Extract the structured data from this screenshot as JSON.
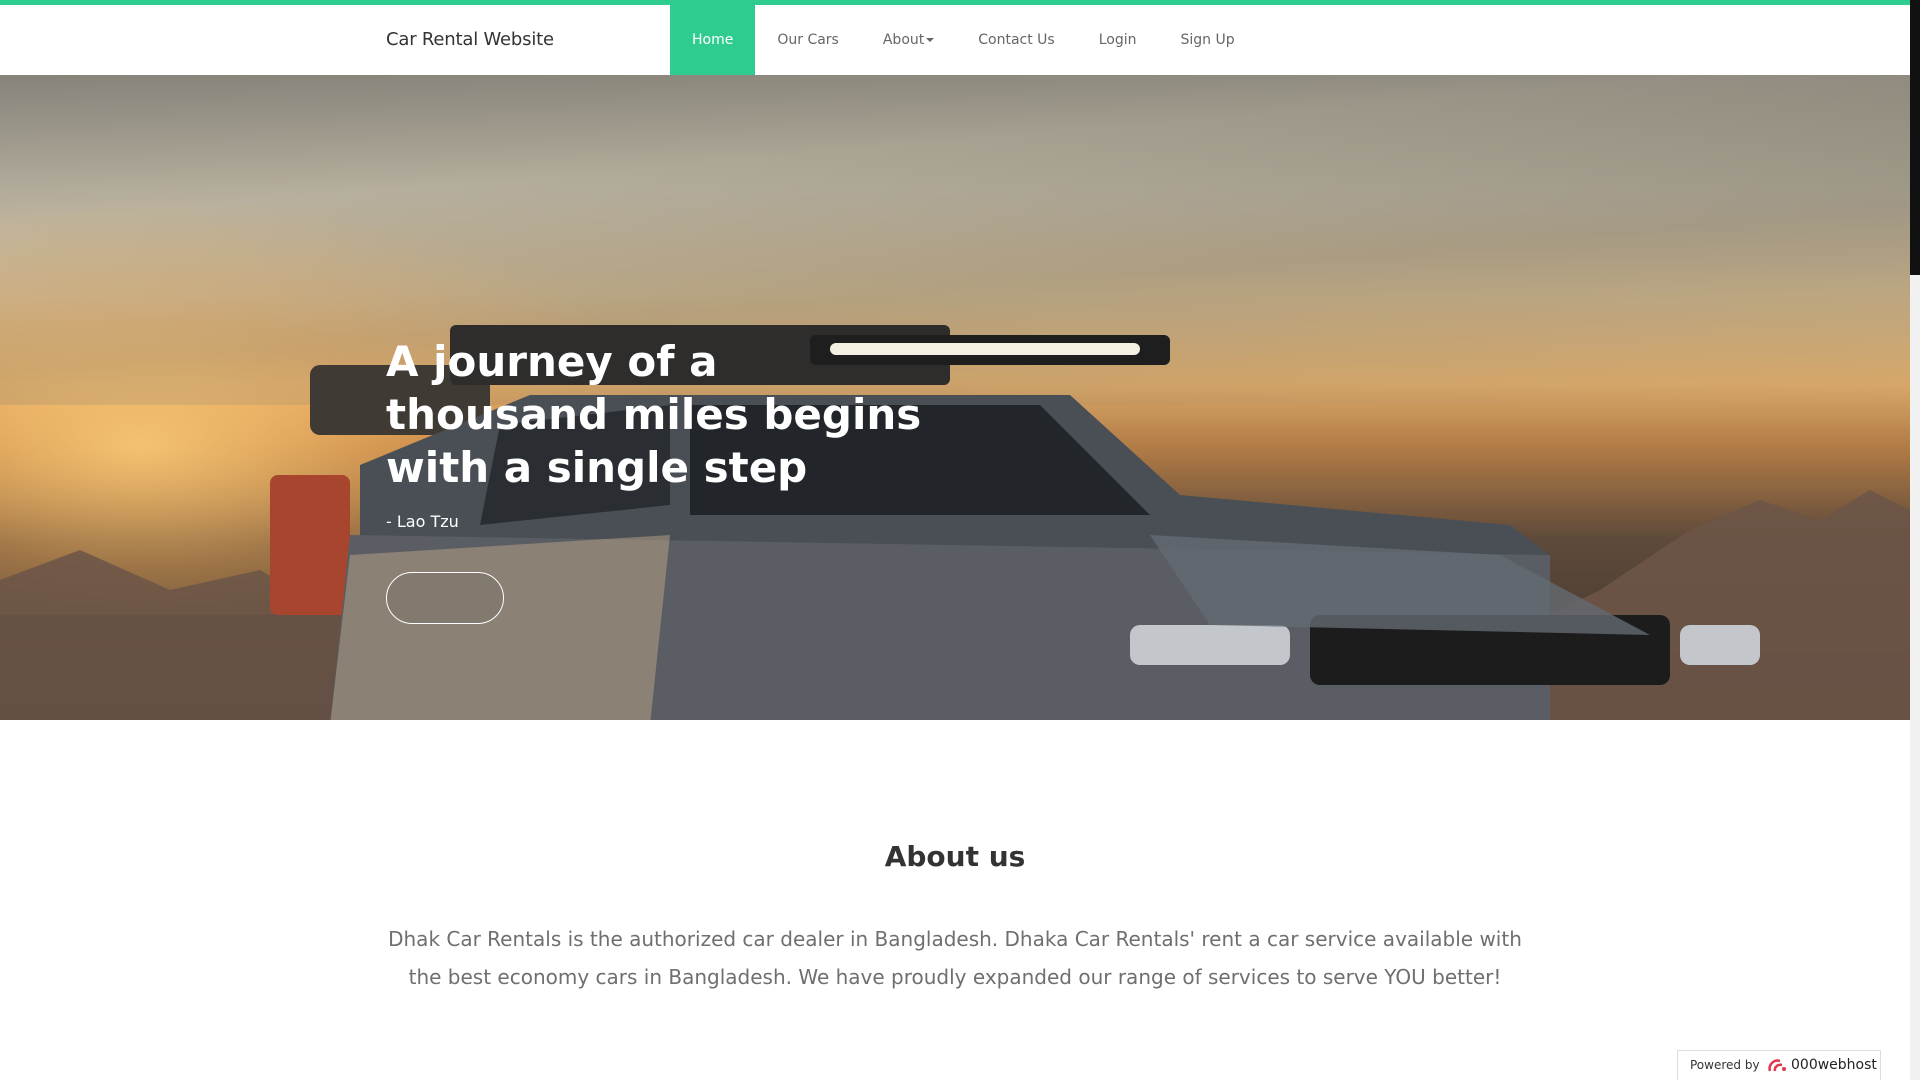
{
  "brand": "Car Rental Website",
  "nav": {
    "home": "Home",
    "cars": "Our Cars",
    "about": "About",
    "contact": "Contact Us",
    "login": "Login",
    "signup": "Sign Up"
  },
  "hero": {
    "title": "A journey of a thousand miles begins with a single step",
    "author": "- Lao Tzu"
  },
  "about": {
    "title": "About us",
    "text": "Dhak Car Rentals is the authorized car dealer in Bangladesh. Dhaka Car Rentals' rent a car service available with the best economy cars in Bangladesh. We have proudly expanded our range of services to serve YOU better!"
  },
  "footer_badge": {
    "powered_by": "Powered by",
    "host": "000webhost"
  },
  "colors": {
    "accent": "#2ecc8f",
    "text_dark": "#333333",
    "text_muted": "#6f6f6f"
  }
}
